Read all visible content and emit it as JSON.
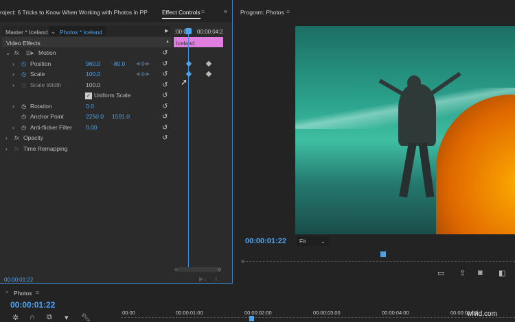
{
  "effect_controls": {
    "project_tab": "roject: 6 Tricks to Know When Working with Photos in PP",
    "tab": "Effect Controls",
    "master_label": "Master * Iceland",
    "clip_label": "Photos * Iceland",
    "ruler_start": ":00:00",
    "ruler_end": "00:00:04:2",
    "clip_bar": "Iceland",
    "video_effects": "Video Effects",
    "motion": "Motion",
    "fx": "fx",
    "props": [
      {
        "name": "Position",
        "v1": "960.0",
        "v2": "-80.0"
      },
      {
        "name": "Scale",
        "v1": "100.0"
      },
      {
        "name": "Scale Width",
        "v1": "100.0"
      },
      {
        "name": "Uniform Scale"
      },
      {
        "name": "Rotation",
        "v1": "0.0"
      },
      {
        "name": "Anchor Point",
        "v1": "2250.0",
        "v2": "1591.0"
      },
      {
        "name": "Anti-flicker Filter",
        "v1": "0.00"
      }
    ],
    "opacity": "Opacity",
    "time_remapping": "Time Remapping",
    "timecode": "00:00:01:22"
  },
  "program": {
    "title": "Program: Photos",
    "timecode": "00:00:01:22",
    "fit": "Fit",
    "playhead_fraction": 0.52
  },
  "timeline": {
    "title": "Photos",
    "timecode": "00:00:01:22",
    "ticks": [
      ":00:00",
      "00:00:01:00",
      "00:00:02:00",
      "00:00:03:00",
      "00:00:04:00",
      "00:00:05:00"
    ]
  },
  "watermark": "wlvid.com"
}
